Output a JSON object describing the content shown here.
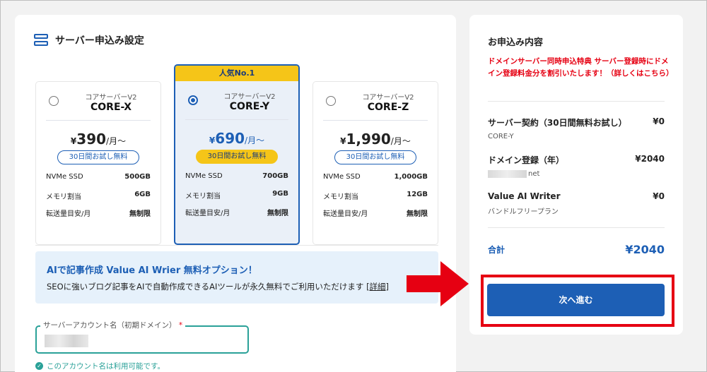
{
  "section": {
    "title": "サーバー申込み設定"
  },
  "plans": [
    {
      "sub": "コアサーバーV2",
      "name": "CORE-X",
      "yen": "¥",
      "price": "390",
      "unit": "/月〜",
      "trial": "30日間お試し無料",
      "specs": [
        {
          "k": "NVMe SSD",
          "v": "500GB"
        },
        {
          "k": "メモリ割当",
          "v": "6GB"
        },
        {
          "k": "転送量目安/月",
          "v": "無制限"
        }
      ]
    },
    {
      "tag": "人気No.1",
      "sub": "コアサーバーV2",
      "name": "CORE-Y",
      "yen": "¥",
      "price": "690",
      "unit": "/月〜",
      "trial": "30日間お試し無料",
      "specs": [
        {
          "k": "NVMe SSD",
          "v": "700GB"
        },
        {
          "k": "メモリ割当",
          "v": "9GB"
        },
        {
          "k": "転送量目安/月",
          "v": "無制限"
        }
      ]
    },
    {
      "sub": "コアサーバーV2",
      "name": "CORE-Z",
      "yen": "¥",
      "price": "1,990",
      "unit": "/月〜",
      "trial": "30日間お試し無料",
      "specs": [
        {
          "k": "NVMe SSD",
          "v": "1,000GB"
        },
        {
          "k": "メモリ割当",
          "v": "12GB"
        },
        {
          "k": "転送量目安/月",
          "v": "無制限"
        }
      ]
    }
  ],
  "selected_plan": "CORE-Y",
  "ai_option": {
    "title": "AIで記事作成 Value AI Wrier 無料オプション！",
    "desc": "SEOに強いブログ記事をAIで自動作成できるAIツールが永久無料でご利用いただけます",
    "link": "[詳細]"
  },
  "account": {
    "label": "サーバーアカウント名（初期ドメイン）",
    "required": "*",
    "ok_message": "このアカウント名は利用可能です。"
  },
  "summary": {
    "title": "お申込み内容",
    "promo": "ドメインサーバー同時申込特典 サーバー登録時にドメイン登録料金分を割引いたします！（詳しくはこちら）",
    "items": [
      {
        "label": "サーバー契約（30日間無料お試し）",
        "amount": "¥0",
        "sub": "CORE-Y"
      },
      {
        "label": "ドメイン登録（年）",
        "amount": "¥2040",
        "sub": "net"
      },
      {
        "label": "Value AI Writer",
        "amount": "¥0",
        "sub": "バンドルフリープラン"
      }
    ],
    "total_label": "合計",
    "total_amount": "¥2040",
    "next_button": "次へ進む"
  },
  "colors": {
    "accent": "#1d5fb5",
    "highlight": "#e60012",
    "badge": "#f5c518",
    "success": "#2aa198"
  }
}
